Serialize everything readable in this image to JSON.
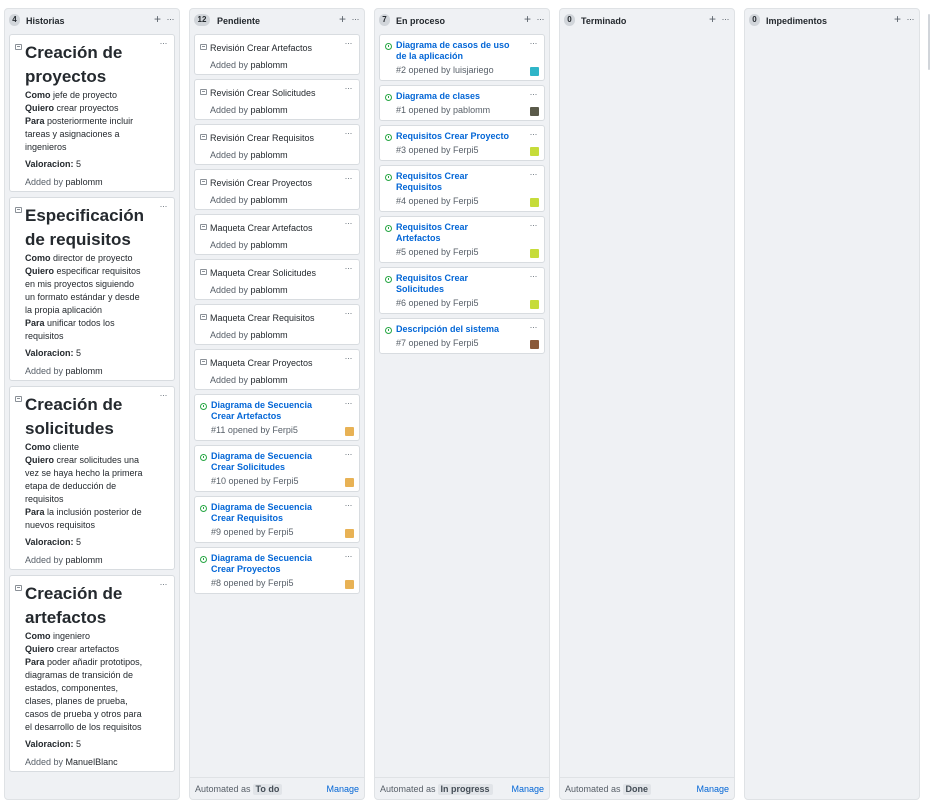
{
  "columns": [
    {
      "count": "4",
      "name": "Historias",
      "stories": [
        {
          "title": "Creación de proyectos",
          "lines": [
            {
              "k": "Como",
              "v": " jefe de proyecto"
            },
            {
              "k": "Quiero",
              "v": " crear proyectos"
            },
            {
              "k": "Para",
              "v": " posteriormente incluir"
            },
            {
              "k": "",
              "v": "tareas y asignaciones a"
            },
            {
              "k": "",
              "v": "ingenieros"
            }
          ],
          "valoracion_label": "Valoracion:",
          "valoracion": " 5",
          "added_prefix": "Added by",
          "added_by": "pablomm"
        },
        {
          "title": "Especificación de requisitos",
          "lines": [
            {
              "k": "Como",
              "v": " director de proyecto"
            },
            {
              "k": "Quiero",
              "v": " especificar requisitos"
            },
            {
              "k": "",
              "v": "en mis proyectos siguiendo"
            },
            {
              "k": "",
              "v": "un formato estándar y desde"
            },
            {
              "k": "",
              "v": "la propia aplicación"
            },
            {
              "k": "Para",
              "v": " unificar todos los"
            },
            {
              "k": "",
              "v": "requisitos"
            }
          ],
          "valoracion_label": "Valoracion:",
          "valoracion": " 5",
          "added_prefix": "Added by",
          "added_by": "pablomm"
        },
        {
          "title": "Creación de solicitudes",
          "lines": [
            {
              "k": "Como",
              "v": " cliente"
            },
            {
              "k": "Quiero",
              "v": " crear solicitudes una"
            },
            {
              "k": "",
              "v": "vez se haya hecho la primera"
            },
            {
              "k": "",
              "v": "etapa de deducción de"
            },
            {
              "k": "",
              "v": "requisitos"
            },
            {
              "k": "Para",
              "v": " la inclusión posterior de"
            },
            {
              "k": "",
              "v": "nuevos requisitos"
            }
          ],
          "valoracion_label": "Valoracion:",
          "valoracion": " 5",
          "added_prefix": "Added by",
          "added_by": "pablomm"
        },
        {
          "title": "Creación de artefactos",
          "lines": [
            {
              "k": "Como",
              "v": " ingeniero"
            },
            {
              "k": "Quiero",
              "v": " crear artefactos"
            },
            {
              "k": "Para",
              "v": " poder añadir prototipos,"
            },
            {
              "k": "",
              "v": "diagramas de transición de"
            },
            {
              "k": "",
              "v": "estados, componentes,"
            },
            {
              "k": "",
              "v": "clases, planes de prueba,"
            },
            {
              "k": "",
              "v": "casos de prueba y otros para"
            },
            {
              "k": "",
              "v": "el desarrollo de los requisitos"
            }
          ],
          "valoracion_label": "Valoracion:",
          "valoracion": " 5",
          "added_prefix": "Added by",
          "added_by": "ManuelBlanc"
        }
      ],
      "footer": null
    },
    {
      "count": "12",
      "name": "Pendiente",
      "notes": [
        {
          "text": "Revisión Crear Artefactos",
          "added_prefix": "Added by",
          "added_by": "pablomm"
        },
        {
          "text": "Revisión Crear Solicitudes",
          "added_prefix": "Added by",
          "added_by": "pablomm"
        },
        {
          "text": "Revisión Crear Requisitos",
          "added_prefix": "Added by",
          "added_by": "pablomm"
        },
        {
          "text": "Revisión Crear Proyectos",
          "added_prefix": "Added by",
          "added_by": "pablomm"
        },
        {
          "text": "Maqueta Crear Artefactos",
          "added_prefix": "Added by",
          "added_by": "pablomm"
        },
        {
          "text": "Maqueta Crear Solicitudes",
          "added_prefix": "Added by",
          "added_by": "pablomm"
        },
        {
          "text": "Maqueta Crear Requisitos",
          "added_prefix": "Added by",
          "added_by": "pablomm"
        },
        {
          "text": "Maqueta Crear Proyectos",
          "added_prefix": "Added by",
          "added_by": "pablomm"
        }
      ],
      "issues": [
        {
          "title1": "Diagrama de Secuencia",
          "title2": "Crear Artefactos",
          "meta": "#11 opened by Ferpi5"
        },
        {
          "title1": "Diagrama de Secuencia",
          "title2": "Crear Solicitudes",
          "meta": "#10 opened by Ferpi5"
        },
        {
          "title1": "Diagrama de Secuencia",
          "title2": "Crear Requisitos",
          "meta": "#9 opened by Ferpi5"
        },
        {
          "title1": "Diagrama de Secuencia",
          "title2": "Crear Proyectos",
          "meta": "#8 opened by Ferpi5"
        }
      ],
      "footer": {
        "prefix": "Automated as",
        "badge": "To do",
        "manage": "Manage"
      }
    },
    {
      "count": "7",
      "name": "En proceso",
      "issues": [
        {
          "title1": "Diagrama de casos de uso",
          "title2": "de la aplicación",
          "meta": "#2 opened by luisjariego"
        },
        {
          "title1": "Diagrama de clases",
          "title2": "",
          "meta": "#1 opened by pablomm"
        },
        {
          "title1": "Requisitos Crear Proyecto",
          "title2": "",
          "meta": "#3 opened by Ferpi5"
        },
        {
          "title1": "Requisitos Crear",
          "title2": "Requisitos",
          "meta": "#4 opened by Ferpi5"
        },
        {
          "title1": "Requisitos Crear",
          "title2": "Artefactos",
          "meta": "#5 opened by Ferpi5"
        },
        {
          "title1": "Requisitos Crear",
          "title2": "Solicitudes",
          "meta": "#6 opened by Ferpi5"
        },
        {
          "title1": "Descripción del sistema",
          "title2": "",
          "meta": "#7 opened by Ferpi5"
        }
      ],
      "footer": {
        "prefix": "Automated as",
        "badge": "In progress",
        "manage": "Manage"
      }
    },
    {
      "count": "0",
      "name": "Terminado",
      "footer": {
        "prefix": "Automated as",
        "badge": "Done",
        "manage": "Manage"
      }
    },
    {
      "count": "0",
      "name": "Impedimentos",
      "footer": null
    }
  ],
  "icons": {
    "add": "+",
    "more": "···"
  },
  "colors": {
    "link": "#0366d6",
    "issue_open": "#28a745",
    "avatar_ferpi5": "#c6dc3a",
    "avatar_ferpi5_sd": "#e8b255",
    "avatar_luisjariego": "#2fb5c8",
    "avatar_pablomm": "#5a5a4a",
    "avatar_desc": "#8a5a3a"
  }
}
